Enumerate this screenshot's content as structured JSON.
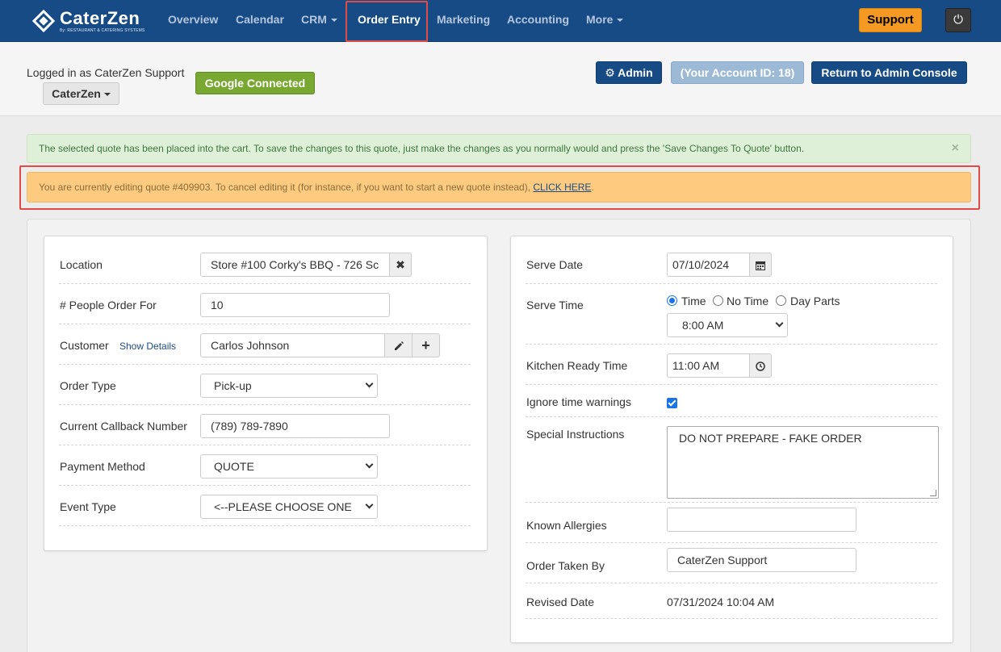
{
  "app": {
    "logo_text": "CaterZen",
    "logo_subtext": "By: RESTAURANT & CATERING SYSTEMS"
  },
  "nav": {
    "items": [
      {
        "label": "Overview"
      },
      {
        "label": "Calendar"
      },
      {
        "label": "CRM"
      },
      {
        "label": "Order Entry"
      },
      {
        "label": "Marketing"
      },
      {
        "label": "Accounting"
      },
      {
        "label": "More"
      }
    ],
    "active": "Order Entry",
    "support_label": "Support",
    "power_icon": "⏻"
  },
  "subheader": {
    "logged_in_text": "Logged in as CaterZen Support",
    "account_dropdown": "CaterZen",
    "google_label": "Google Connected",
    "admin_label": "Admin",
    "account_id_label": "(Your Account ID: 18)",
    "return_label": "Return to Admin Console"
  },
  "alerts": {
    "success_text": "The selected quote has been placed into the cart. To save the changes to this quote, just make the changes as you normally would and press the 'Save Changes To Quote' button.",
    "close_symbol": "×",
    "warning_text": "You are currently editing quote #409903. To cancel editing it (for instance, if you want to start a new quote instead), ",
    "warning_link": "CLICK HERE",
    "warning_suffix": "."
  },
  "left_form": {
    "location": {
      "label": "Location",
      "value": "Store #100 Corky's BBQ - 726 Sc",
      "clear_symbol": "✖"
    },
    "people": {
      "label": "# People Order For",
      "value": "10"
    },
    "customer": {
      "label": "Customer",
      "show_details": "Show Details",
      "value": "Carlos Johnson",
      "plus_symbol": "+"
    },
    "order_type": {
      "label": "Order Type",
      "value": "Pick-up"
    },
    "callback": {
      "label": "Current Callback Number",
      "value": "(789) 789-7890"
    },
    "payment": {
      "label": "Payment Method",
      "value": "QUOTE"
    },
    "event_type": {
      "label": "Event Type",
      "value": "<--PLEASE CHOOSE ONE"
    }
  },
  "right_form": {
    "serve_date": {
      "label": "Serve Date",
      "value": "07/10/2024"
    },
    "serve_time": {
      "label": "Serve Time",
      "options": [
        "Time",
        "No Time",
        "Day Parts"
      ],
      "selected": "Time",
      "time_value": "8:00 AM"
    },
    "kitchen_ready": {
      "label": "Kitchen Ready Time",
      "value": "11:00 AM"
    },
    "ignore_warnings": {
      "label": "Ignore time warnings",
      "checked": true
    },
    "special_instructions": {
      "label": "Special Instructions",
      "value": "DO NOT PREPARE - FAKE ORDER"
    },
    "allergies": {
      "label": "Known Allergies",
      "value": ""
    },
    "taken_by": {
      "label": "Order Taken By",
      "value": "CaterZen Support"
    },
    "revised": {
      "label": "Revised Date",
      "value": "07/31/2024 10:04 AM"
    }
  },
  "colors": {
    "navbar": "#164b85",
    "support": "#f49a22",
    "google": "#79a832",
    "highlight_border": "#e24b45",
    "warning_bg": "#fdcb7f",
    "success_bg": "#dff0d8"
  }
}
